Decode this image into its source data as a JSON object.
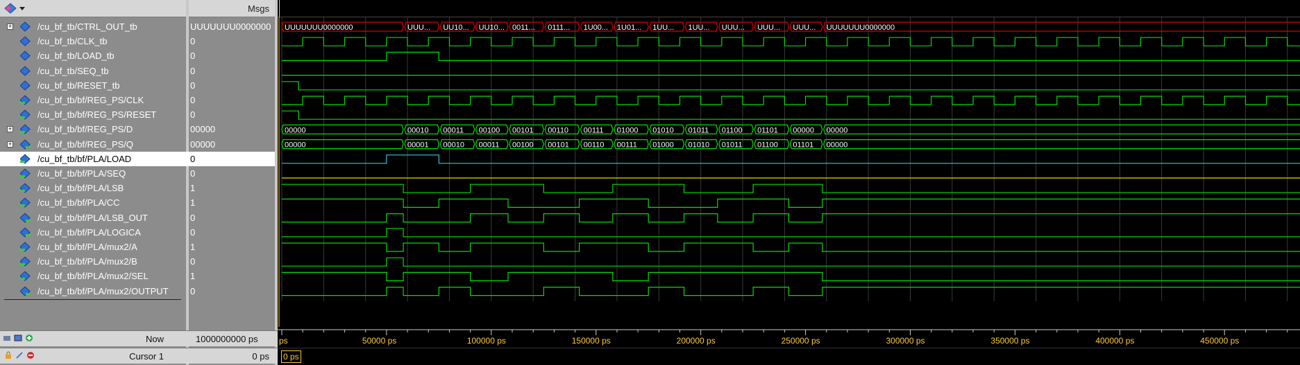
{
  "header": {
    "msgs_label": "Msgs"
  },
  "signals": [
    {
      "name": "/cu_bf_tb/CTRL_OUT_tb",
      "value": "UUUUUUU0000000",
      "expandable": true,
      "type": "bus",
      "icon": "signal-diamond-icon"
    },
    {
      "name": "/cu_bf_tb/CLK_tb",
      "value": "0",
      "expandable": false,
      "type": "clock",
      "icon": "signal-diamond-icon"
    },
    {
      "name": "/cu_bf_tb/LOAD_tb",
      "value": "0",
      "expandable": false,
      "type": "bit",
      "icon": "signal-diamond-icon"
    },
    {
      "name": "/cu_bf_tb/SEQ_tb",
      "value": "0",
      "expandable": false,
      "type": "bit",
      "icon": "signal-diamond-icon"
    },
    {
      "name": "/cu_bf_tb/RESET_tb",
      "value": "0",
      "expandable": false,
      "type": "bit",
      "icon": "signal-diamond-icon"
    },
    {
      "name": "/cu_bf_tb/bf/REG_PS/CLK",
      "value": "0",
      "expandable": false,
      "type": "clock",
      "icon": "input-port-icon"
    },
    {
      "name": "/cu_bf_tb/bf/REG_PS/RESET",
      "value": "0",
      "expandable": false,
      "type": "bit",
      "icon": "input-port-icon"
    },
    {
      "name": "/cu_bf_tb/bf/REG_PS/D",
      "value": "00000",
      "expandable": true,
      "type": "bus",
      "icon": "input-port-icon"
    },
    {
      "name": "/cu_bf_tb/bf/REG_PS/Q",
      "value": "00000",
      "expandable": true,
      "type": "bus",
      "icon": "output-port-icon"
    },
    {
      "name": "/cu_bf_tb/bf/PLA/LOAD",
      "value": "0",
      "expandable": false,
      "type": "bit",
      "icon": "input-port-icon",
      "selected": true
    },
    {
      "name": "/cu_bf_tb/bf/PLA/SEQ",
      "value": "0",
      "expandable": false,
      "type": "bit",
      "icon": "input-port-icon"
    },
    {
      "name": "/cu_bf_tb/bf/PLA/LSB",
      "value": "1",
      "expandable": false,
      "type": "bit",
      "icon": "input-port-icon"
    },
    {
      "name": "/cu_bf_tb/bf/PLA/CC",
      "value": "1",
      "expandable": false,
      "type": "bit",
      "icon": "input-port-icon"
    },
    {
      "name": "/cu_bf_tb/bf/PLA/LSB_OUT",
      "value": "0",
      "expandable": false,
      "type": "bit",
      "icon": "output-port-icon"
    },
    {
      "name": "/cu_bf_tb/bf/PLA/LOGICA",
      "value": "0",
      "expandable": false,
      "type": "bit",
      "icon": "output-port-icon"
    },
    {
      "name": "/cu_bf_tb/bf/PLA/mux2/A",
      "value": "1",
      "expandable": false,
      "type": "bit",
      "icon": "input-port-icon"
    },
    {
      "name": "/cu_bf_tb/bf/PLA/mux2/B",
      "value": "0",
      "expandable": false,
      "type": "bit",
      "icon": "input-port-icon"
    },
    {
      "name": "/cu_bf_tb/bf/PLA/mux2/SEL",
      "value": "1",
      "expandable": false,
      "type": "bit",
      "icon": "input-port-icon"
    },
    {
      "name": "/cu_bf_tb/bf/PLA/mux2/OUTPUT",
      "value": "0",
      "expandable": false,
      "type": "bit",
      "icon": "output-port-icon"
    }
  ],
  "waves": {
    "ctrl_out_labels": [
      "UUUUUUU0000000",
      "UUU...",
      "UU10...",
      "UU10...",
      "0011...",
      "0111...",
      "1U00...",
      "1U01...",
      "1UU...",
      "1UU...",
      "UUU...",
      "UUU...",
      "UUU...",
      "UUUUUUU0000000"
    ],
    "d_labels": [
      "00000",
      "00010",
      "00011",
      "00100",
      "00101",
      "00110",
      "00111",
      "01000",
      "01010",
      "01011",
      "01100",
      "01101",
      "00000",
      "00000"
    ],
    "q_labels": [
      "00000",
      "00001",
      "00010",
      "00011",
      "00100",
      "00101",
      "00110",
      "00111",
      "01000",
      "01010",
      "01011",
      "01100",
      "01101",
      "00000"
    ]
  },
  "footer": {
    "now_label": "Now",
    "now_value": "1000000000 ps",
    "cursor_label": "Cursor 1",
    "cursor_value": "0 ps",
    "cursor_marker": "0 ps"
  },
  "time_axis": {
    "labels": [
      "ps",
      "50000 ps",
      "100000 ps",
      "150000 ps",
      "200000 ps",
      "250000 ps",
      "300000 ps",
      "350000 ps",
      "400000 ps",
      "450000 ps"
    ]
  },
  "colors": {
    "wave_green": "#00e000",
    "bus_red": "#e00000",
    "selected_cyan": "#30c8e0",
    "seq_yellow": "#e8d800",
    "cursor": "#ffcc33"
  }
}
